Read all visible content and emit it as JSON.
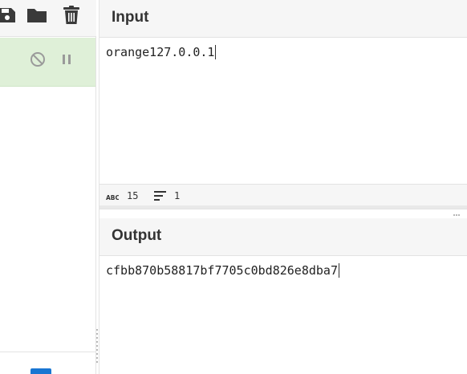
{
  "toolbar": {
    "icons": [
      "save-icon",
      "folder-icon",
      "trash-icon"
    ]
  },
  "recipe": {
    "operation_icons": [
      "disable-icon",
      "pause-icon"
    ],
    "colors": {
      "active_bg": "#dff0d8",
      "accent": "#1976d2"
    }
  },
  "input": {
    "title": "Input",
    "value": "orange127.0.0.1",
    "stats": {
      "length": "15",
      "lines": "1"
    }
  },
  "output": {
    "title": "Output",
    "value": "cfbb870b58817bf7705c0bd826e8dba7"
  }
}
